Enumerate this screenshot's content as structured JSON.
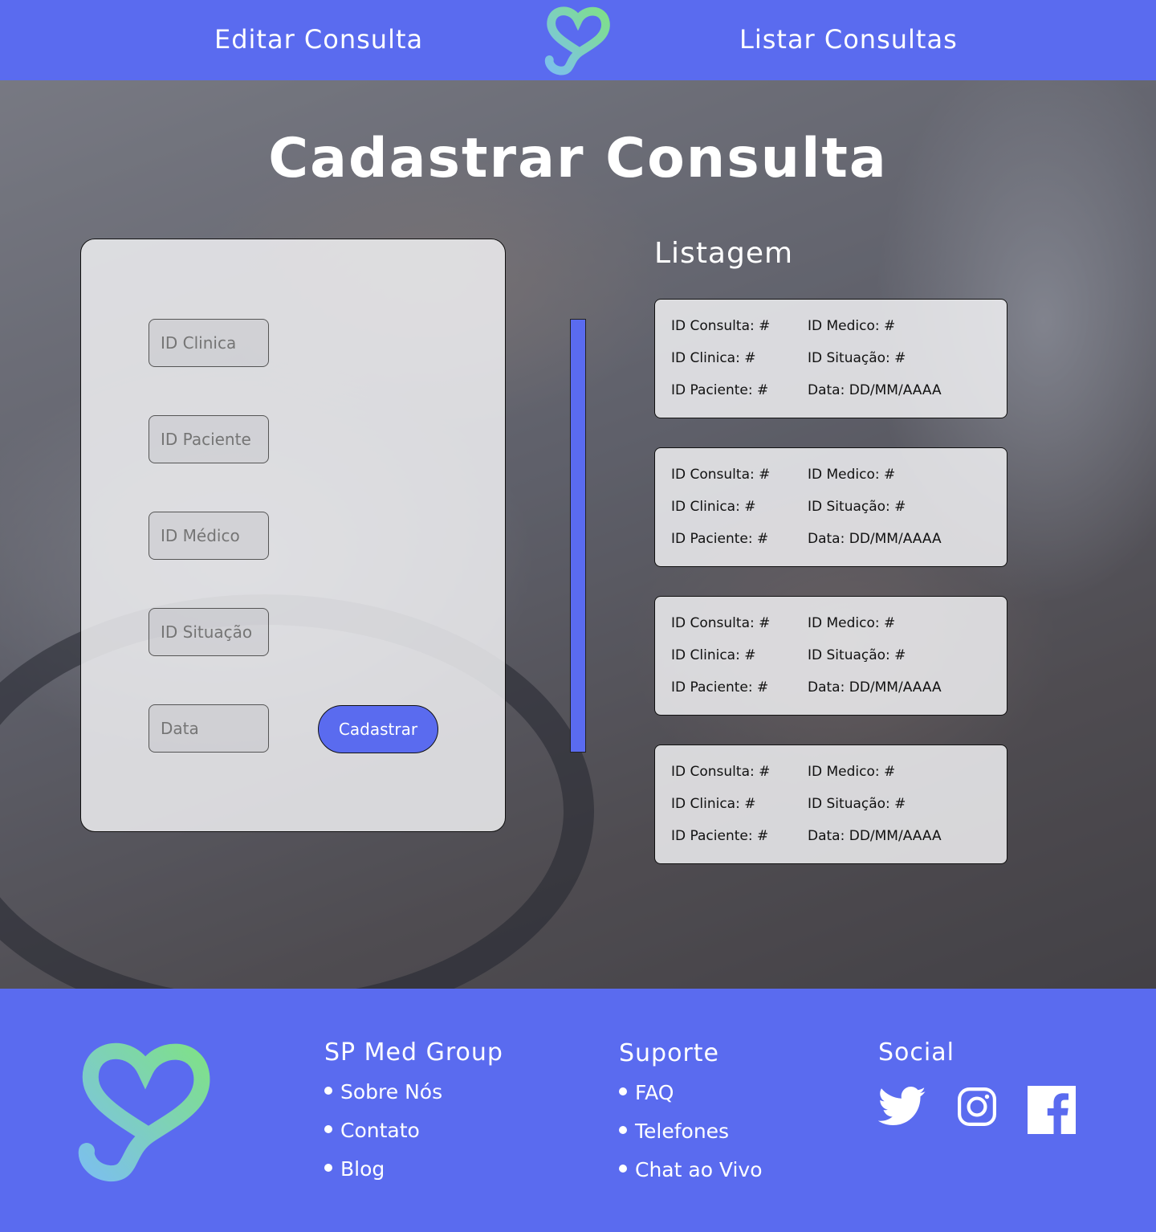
{
  "header": {
    "nav_left": "Editar Consulta",
    "nav_right": "Listar Consultas"
  },
  "page": {
    "title": "Cadastrar Consulta"
  },
  "form": {
    "fields": [
      {
        "placeholder": "ID Clinica"
      },
      {
        "placeholder": "ID Paciente"
      },
      {
        "placeholder": "ID Médico"
      },
      {
        "placeholder": "ID Situação"
      },
      {
        "placeholder": "Data"
      }
    ],
    "submit_label": "Cadastrar"
  },
  "listing": {
    "title": "Listagem",
    "cards": [
      {
        "consulta": "ID Consulta: #",
        "medico": "ID Medico: #",
        "clinica": "ID Clinica: #",
        "situacao": "ID Situação: #",
        "paciente": "ID Paciente: #",
        "data": "Data: DD/MM/AAAA"
      },
      {
        "consulta": "ID Consulta: #",
        "medico": "ID Medico: #",
        "clinica": "ID Clinica: #",
        "situacao": "ID Situação: #",
        "paciente": "ID Paciente: #",
        "data": "Data: DD/MM/AAAA"
      },
      {
        "consulta": "ID Consulta: #",
        "medico": "ID Medico: #",
        "clinica": "ID Clinica: #",
        "situacao": "ID Situação: #",
        "paciente": "ID Paciente: #",
        "data": "Data: DD/MM/AAAA"
      },
      {
        "consulta": "ID Consulta: #",
        "medico": "ID Medico: #",
        "clinica": "ID Clinica: #",
        "situacao": "ID Situação: #",
        "paciente": "ID Paciente: #",
        "data": "Data: DD/MM/AAAA"
      }
    ]
  },
  "footer": {
    "col1": {
      "title": "SP Med Group",
      "links": [
        "Sobre Nós",
        "Contato",
        "Blog"
      ]
    },
    "col2": {
      "title": "Suporte",
      "links": [
        "FAQ",
        "Telefones",
        "Chat ao Vivo"
      ]
    },
    "col3": {
      "title": "Social",
      "icons": [
        "twitter-icon",
        "instagram-icon",
        "facebook-icon"
      ]
    }
  },
  "colors": {
    "brand": "#5a6bef",
    "logo_green": "#7fe08a",
    "logo_blue": "#7cc0ec"
  }
}
